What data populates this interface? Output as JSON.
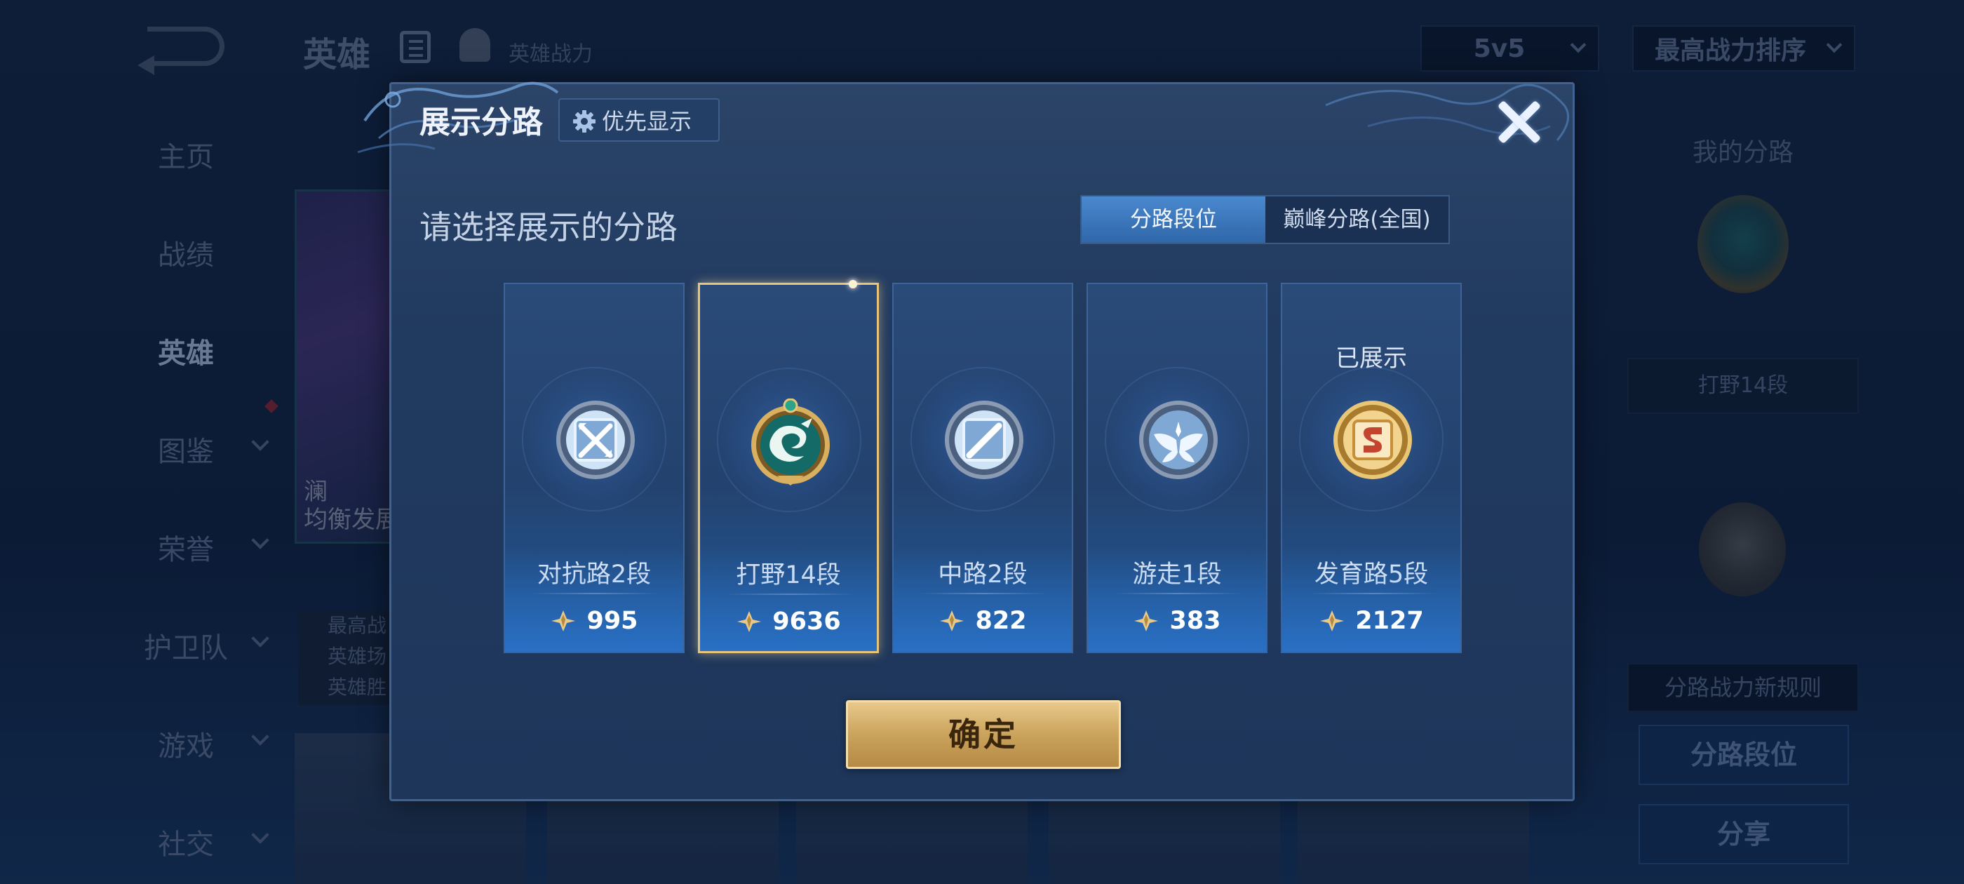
{
  "topbar": {
    "title": "英雄",
    "power_label": "英雄战力",
    "mode_select": "5v5",
    "sort_select": "最高战力排序"
  },
  "sidebar": {
    "items": [
      {
        "label": "主页"
      },
      {
        "label": "战绩"
      },
      {
        "label": "英雄"
      },
      {
        "label": "图鉴"
      },
      {
        "label": "荣誉"
      },
      {
        "label": "护卫队"
      },
      {
        "label": "游戏"
      },
      {
        "label": "社交"
      }
    ]
  },
  "hero_card": {
    "name": "澜",
    "tag": "均衡发展",
    "stats": [
      "最高战",
      "英雄场",
      "英雄胜"
    ]
  },
  "right_panel": {
    "title": "我的分路",
    "badge_label": "打野14段",
    "rules_link": "分路战力新规则",
    "lane_rank_button": "分路段位",
    "share_button": "分享"
  },
  "dialog": {
    "title": "展示分路",
    "priority_button": "优先显示",
    "subtitle": "请选择展示的分路",
    "tabs": [
      "分路段位",
      "巅峰分路(全国)"
    ],
    "confirm": "确定",
    "lanes": [
      {
        "name": "对抗路2段",
        "power": "995",
        "icon": "clash-lane-icon",
        "shown": ""
      },
      {
        "name": "打野14段",
        "power": "9636",
        "icon": "jungle-dragon-icon",
        "shown": ""
      },
      {
        "name": "中路2段",
        "power": "822",
        "icon": "mid-lane-icon",
        "shown": ""
      },
      {
        "name": "游走1段",
        "power": "383",
        "icon": "roam-wings-icon",
        "shown": ""
      },
      {
        "name": "发育路5段",
        "power": "2127",
        "icon": "farm-lane-icon",
        "shown": "已展示"
      }
    ]
  },
  "colors": {
    "dialog_bg": "#233d63",
    "selected_border": "#e7c47a",
    "confirm_gold": "#caa35c",
    "tab_active": "#3f7cc2"
  }
}
